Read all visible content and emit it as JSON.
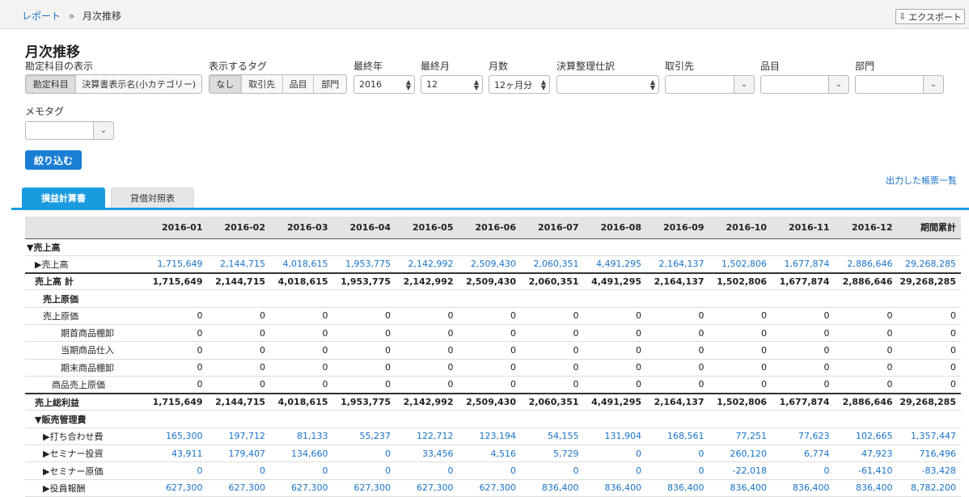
{
  "breadcrumb": {
    "parent": "レポート",
    "sep": "»",
    "current": "月次推移"
  },
  "export_label": "エクスポート",
  "page_title": "月次推移",
  "filters": {
    "account_display": {
      "label": "勘定科目の表示",
      "options": [
        "勘定科目",
        "決算書表示名(小カテゴリー)"
      ],
      "selected": 0
    },
    "tag_display": {
      "label": "表示するタグ",
      "options": [
        "なし",
        "取引先",
        "品目",
        "部門"
      ],
      "selected": 0
    },
    "last_year": {
      "label": "最終年",
      "value": "2016"
    },
    "last_month": {
      "label": "最終月",
      "value": "12"
    },
    "months": {
      "label": "月数",
      "value": "12ヶ月分"
    },
    "closing": {
      "label": "決算整理仕訳",
      "value": ""
    },
    "partner": {
      "label": "取引先"
    },
    "item": {
      "label": "品目"
    },
    "dept": {
      "label": "部門"
    },
    "memo": {
      "label": "メモタグ"
    }
  },
  "filter_button": "絞り込む",
  "reports_link": "出力した帳票一覧",
  "tabs": [
    "損益計算書",
    "貸借対照表"
  ],
  "table": {
    "columns": [
      "",
      "2016-01",
      "2016-02",
      "2016-03",
      "2016-04",
      "2016-05",
      "2016-06",
      "2016-07",
      "2016-08",
      "2016-09",
      "2016-10",
      "2016-11",
      "2016-12",
      "期間累計"
    ],
    "rows": [
      {
        "label": "▼売上高",
        "indent": 0,
        "kind": "section",
        "values": []
      },
      {
        "label": "▶売上高",
        "indent": 1,
        "kind": "link",
        "values": [
          "1,715,649",
          "2,144,715",
          "4,018,615",
          "1,953,775",
          "2,142,992",
          "2,509,430",
          "2,060,351",
          "4,491,295",
          "2,164,137",
          "1,502,806",
          "1,677,874",
          "2,886,646",
          "29,268,285"
        ]
      },
      {
        "label": "売上高 計",
        "indent": 1,
        "kind": "total",
        "values": [
          "1,715,649",
          "2,144,715",
          "4,018,615",
          "1,953,775",
          "2,142,992",
          "2,509,430",
          "2,060,351",
          "4,491,295",
          "2,164,137",
          "1,502,806",
          "1,677,874",
          "2,886,646",
          "29,268,285"
        ]
      },
      {
        "label": "売上原価",
        "indent": 2,
        "kind": "section",
        "values": []
      },
      {
        "label": "売上原価",
        "indent": 2,
        "kind": "plain",
        "values": [
          "0",
          "0",
          "0",
          "0",
          "0",
          "0",
          "0",
          "0",
          "0",
          "0",
          "0",
          "0",
          "0"
        ]
      },
      {
        "label": "期首商品棚卸",
        "indent": 4,
        "kind": "plain",
        "values": [
          "0",
          "0",
          "0",
          "0",
          "0",
          "0",
          "0",
          "0",
          "0",
          "0",
          "0",
          "0",
          "0"
        ]
      },
      {
        "label": "当期商品仕入",
        "indent": 4,
        "kind": "plain",
        "values": [
          "0",
          "0",
          "0",
          "0",
          "0",
          "0",
          "0",
          "0",
          "0",
          "0",
          "0",
          "0",
          "0"
        ]
      },
      {
        "label": "期末商品棚卸",
        "indent": 4,
        "kind": "plain",
        "values": [
          "0",
          "0",
          "0",
          "0",
          "0",
          "0",
          "0",
          "0",
          "0",
          "0",
          "0",
          "0",
          "0"
        ]
      },
      {
        "label": "商品売上原価",
        "indent": 3,
        "kind": "plain",
        "values": [
          "0",
          "0",
          "0",
          "0",
          "0",
          "0",
          "0",
          "0",
          "0",
          "0",
          "0",
          "0",
          "0"
        ]
      },
      {
        "label": "売上総利益",
        "indent": 1,
        "kind": "total",
        "values": [
          "1,715,649",
          "2,144,715",
          "4,018,615",
          "1,953,775",
          "2,142,992",
          "2,509,430",
          "2,060,351",
          "4,491,295",
          "2,164,137",
          "1,502,806",
          "1,677,874",
          "2,886,646",
          "29,268,285"
        ]
      },
      {
        "label": "▼販売管理費",
        "indent": 1,
        "kind": "section",
        "values": []
      },
      {
        "label": "▶打ち合わせ費",
        "indent": 2,
        "kind": "link",
        "values": [
          "165,300",
          "197,712",
          "81,133",
          "55,237",
          "122,712",
          "123,194",
          "54,155",
          "131,904",
          "168,561",
          "77,251",
          "77,623",
          "102,665",
          "1,357,447"
        ]
      },
      {
        "label": "▶セミナー投資",
        "indent": 2,
        "kind": "link",
        "values": [
          "43,911",
          "179,407",
          "134,660",
          "0",
          "33,456",
          "4,516",
          "5,729",
          "0",
          "0",
          "260,120",
          "6,774",
          "47,923",
          "716,496"
        ]
      },
      {
        "label": "▶セミナー原価",
        "indent": 2,
        "kind": "link",
        "values": [
          "0",
          "0",
          "0",
          "0",
          "0",
          "0",
          "0",
          "0",
          "0",
          "-22,018",
          "0",
          "-61,410",
          "-83,428"
        ]
      },
      {
        "label": "▶役員報酬",
        "indent": 2,
        "kind": "link",
        "values": [
          "627,300",
          "627,300",
          "627,300",
          "627,300",
          "627,300",
          "627,300",
          "836,400",
          "836,400",
          "836,400",
          "836,400",
          "836,400",
          "836,400",
          "8,782,200"
        ]
      }
    ]
  }
}
